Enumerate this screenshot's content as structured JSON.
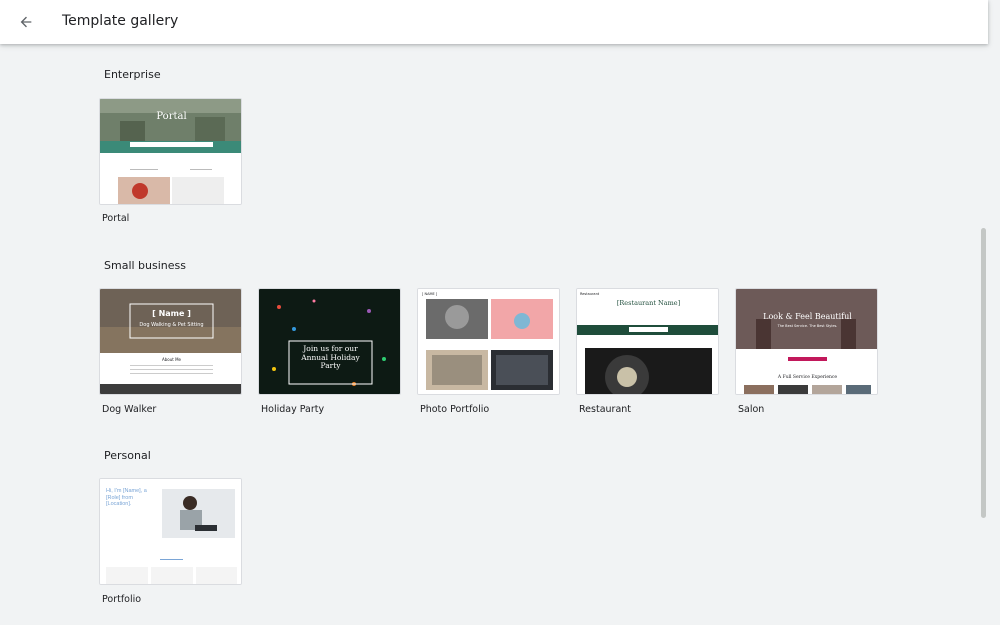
{
  "header": {
    "title": "Template gallery",
    "back_icon": "arrow-back-icon"
  },
  "sections": [
    {
      "title": "Enterprise",
      "templates": [
        {
          "label": "Portal"
        }
      ]
    },
    {
      "title": "Small business",
      "templates": [
        {
          "label": "Dog Walker"
        },
        {
          "label": "Holiday Party"
        },
        {
          "label": "Photo Portfolio"
        },
        {
          "label": "Restaurant"
        },
        {
          "label": "Salon"
        }
      ]
    },
    {
      "title": "Personal",
      "templates": [
        {
          "label": "Portfolio"
        }
      ]
    }
  ],
  "thumbnails": {
    "portal": {
      "heading": "Portal"
    },
    "dog_walker": {
      "heading": "[ Name ]",
      "subheading": "Dog Walking & Pet Sitting",
      "about": "About Me"
    },
    "holiday_party": {
      "heading": "Join us for our Annual Holiday Party"
    },
    "photo_portfolio": {
      "brand": "[ NAME ]"
    },
    "restaurant": {
      "brand": "Restaurant",
      "heading": "[Restaurant Name]"
    },
    "salon": {
      "heading": "Look & Feel Beautiful",
      "subheading": "The Best Service. The Best Styles.",
      "section": "A Full Service Experience"
    },
    "portfolio": {
      "intro": "Hi, I'm [Name], a [Role] from [Location]."
    }
  },
  "colors": {
    "background": "#f1f3f4",
    "portal_teal": "#3b8a78",
    "restaurant_green": "#1f4d3b",
    "salon_pink": "#c2185b"
  }
}
